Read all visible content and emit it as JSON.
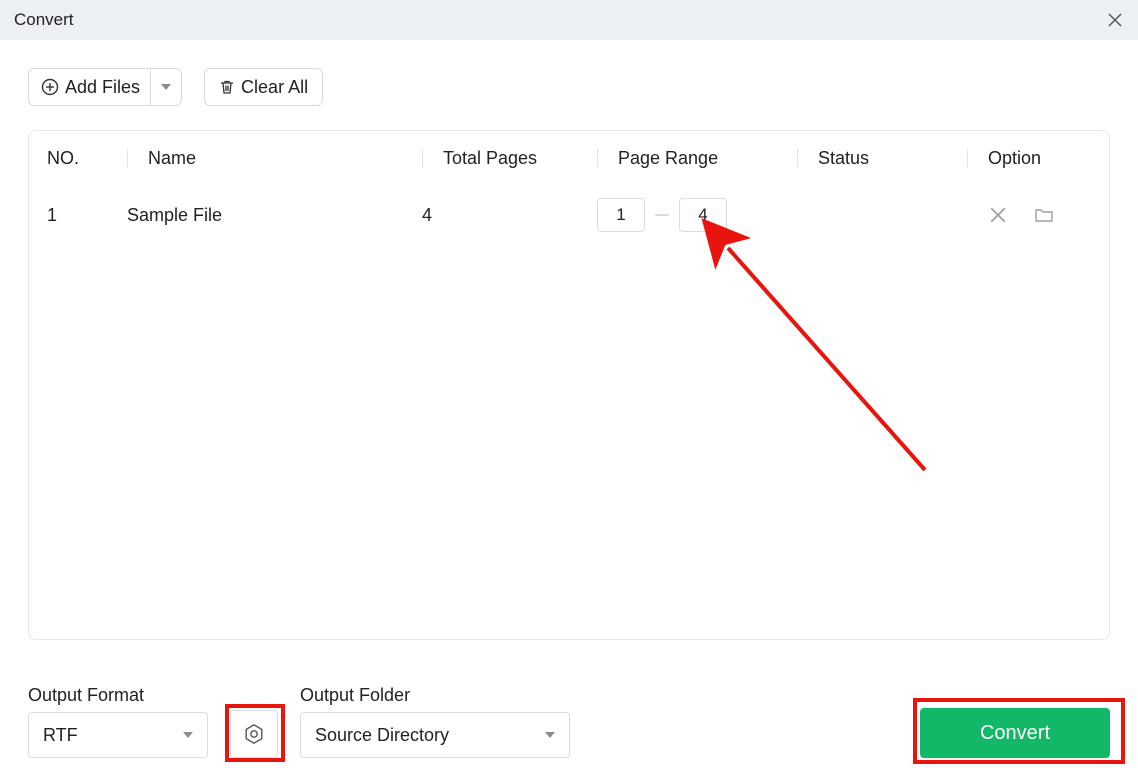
{
  "window": {
    "title": "Convert"
  },
  "toolbar": {
    "add_files_label": "Add Files",
    "clear_all_label": "Clear All"
  },
  "table": {
    "headers": {
      "no": "NO.",
      "name": "Name",
      "total_pages": "Total Pages",
      "page_range": "Page Range",
      "status": "Status",
      "option": "Option"
    },
    "rows": [
      {
        "no": "1",
        "name": "Sample File",
        "total_pages": "4",
        "page_from": "1",
        "page_to": "4",
        "status": ""
      }
    ]
  },
  "footer": {
    "output_format_label": "Output Format",
    "output_format_value": "RTF",
    "output_folder_label": "Output Folder",
    "output_folder_value": "Source Directory",
    "convert_label": "Convert"
  }
}
